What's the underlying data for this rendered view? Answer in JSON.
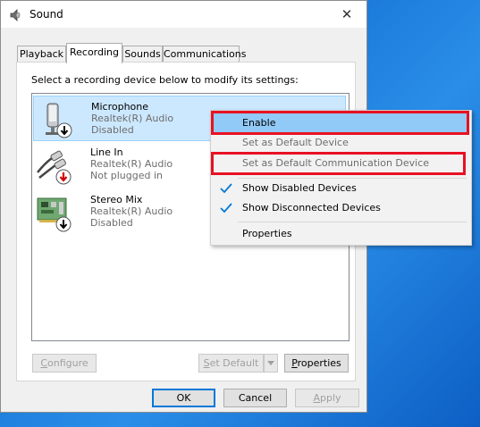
{
  "window": {
    "title": "Sound",
    "close_glyph": "✕"
  },
  "tabs": [
    {
      "label": "Playback"
    },
    {
      "label": "Recording"
    },
    {
      "label": "Sounds"
    },
    {
      "label": "Communications"
    }
  ],
  "active_tab": "Recording",
  "instruction": "Select a recording device below to modify its settings:",
  "devices": [
    {
      "name": "Microphone",
      "driver": "Realtek(R) Audio",
      "status": "Disabled",
      "icon": "microphone-icon",
      "selected": true
    },
    {
      "name": "Line In",
      "driver": "Realtek(R) Audio",
      "status": "Not plugged in",
      "icon": "line-in-cable-icon",
      "selected": false
    },
    {
      "name": "Stereo Mix",
      "driver": "Realtek(R) Audio",
      "status": "Disabled",
      "icon": "sound-card-icon",
      "selected": false
    }
  ],
  "buttons": {
    "configure": "Configure",
    "set_default": "Set Default",
    "properties": "Properties",
    "ok": "OK",
    "cancel": "Cancel",
    "apply": "Apply"
  },
  "context_menu": {
    "items": [
      {
        "label": "Enable",
        "state": "highlighted",
        "annotated": true
      },
      {
        "label": "Set as Default Device",
        "state": "disabled"
      },
      {
        "label": "Set as Default Communication Device",
        "state": "disabled",
        "annotated": true
      },
      {
        "label": "Show Disabled Devices",
        "checked": true
      },
      {
        "label": "Show Disconnected Devices",
        "checked": true
      },
      {
        "label": "Properties"
      }
    ]
  },
  "colors": {
    "selection": "#cce8ff",
    "menu_hover": "#91c9f7",
    "annotation_red": "#e81123",
    "check_blue": "#0078d7",
    "desktop_blue": "#1876d6"
  }
}
